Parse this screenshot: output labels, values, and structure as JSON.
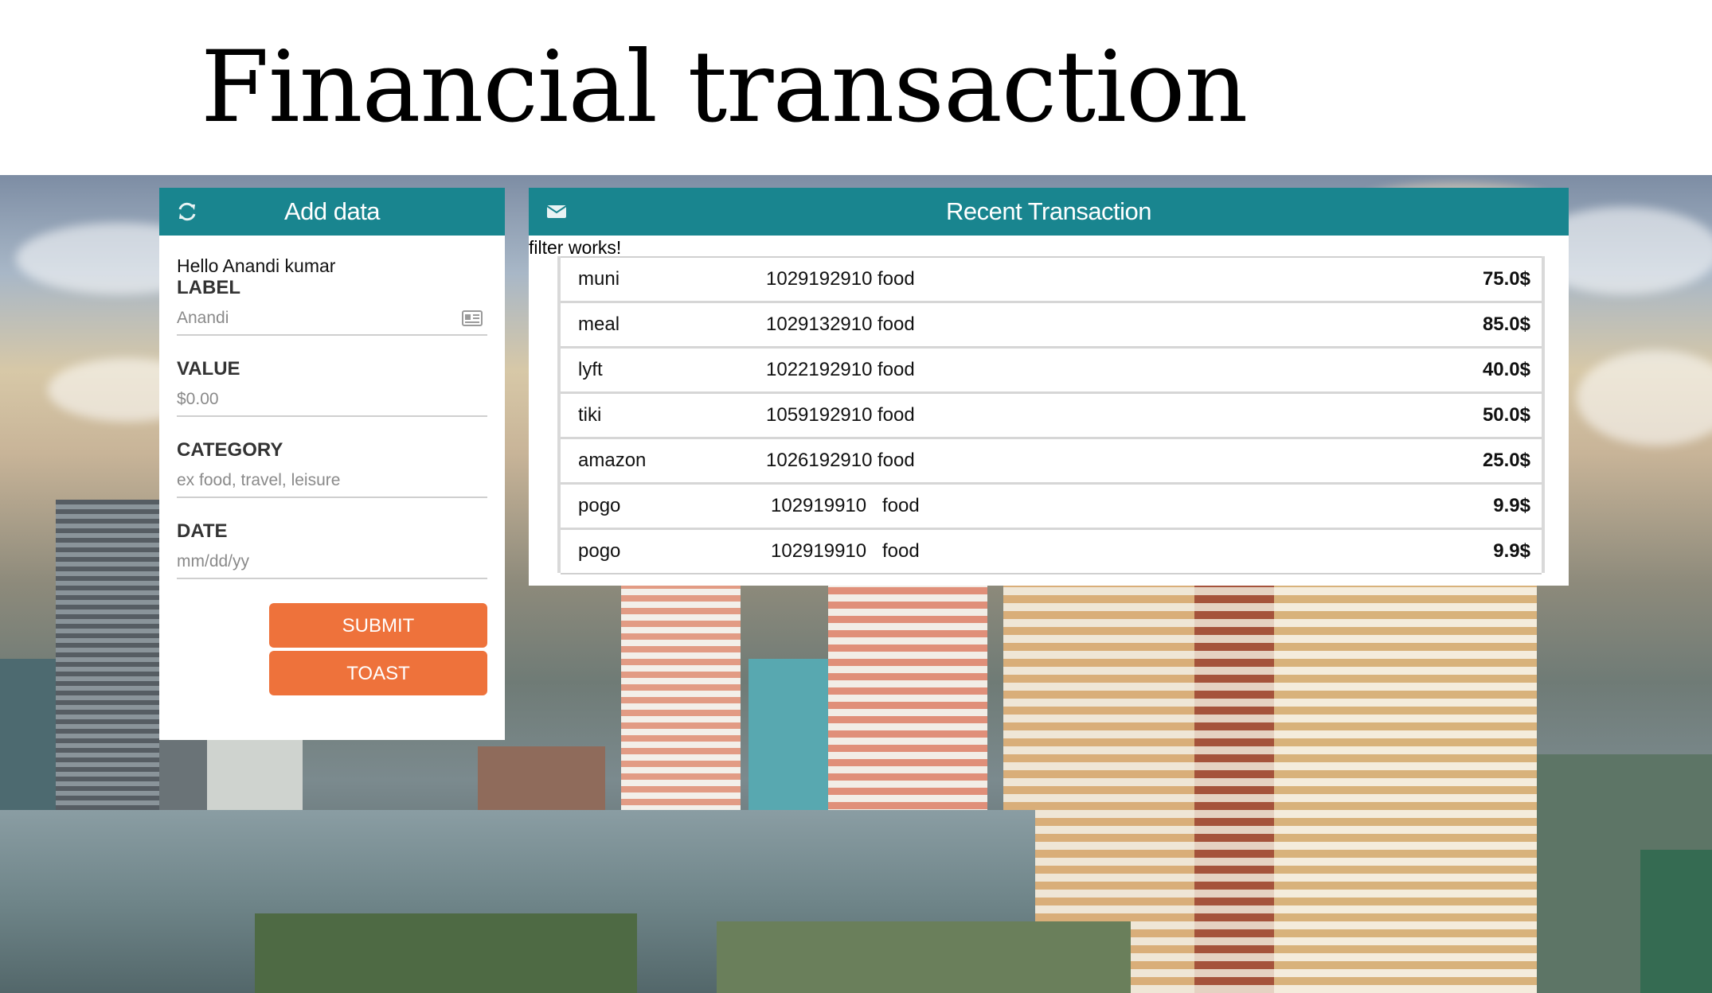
{
  "page": {
    "title": "Financial transaction"
  },
  "add_panel": {
    "title": "Add data",
    "header_icon": "refresh-icon",
    "greeting": "Hello Anandi kumar",
    "fields": {
      "label": {
        "label": "LABEL",
        "placeholder": "Anandi",
        "icon": "contact-card-icon"
      },
      "value": {
        "label": "VALUE",
        "placeholder": "$0.00"
      },
      "category": {
        "label": "CATEGORY",
        "placeholder": "ex food, travel, leisure"
      },
      "date": {
        "label": "DATE",
        "placeholder": "mm/dd/yy"
      }
    },
    "submit_label": "SUBMIT",
    "toast_label": "TOAST"
  },
  "transactions_panel": {
    "title": "Recent Transaction",
    "header_icon": "envelope-icon",
    "filter_message": "filter works!",
    "rows": [
      {
        "label": "muni",
        "id": "1029192910",
        "category": "food",
        "amount": "75.0$"
      },
      {
        "label": "meal",
        "id": "1029132910",
        "category": "food",
        "amount": "85.0$"
      },
      {
        "label": "lyft",
        "id": "1022192910",
        "category": "food",
        "amount": "40.0$"
      },
      {
        "label": "tiki",
        "id": "1059192910",
        "category": "food",
        "amount": "50.0$"
      },
      {
        "label": "amazon",
        "id": "1026192910",
        "category": "food",
        "amount": "25.0$"
      },
      {
        "label": "pogo",
        "id": "102919910",
        "category": "food",
        "amount": "9.9$"
      },
      {
        "label": "pogo",
        "id": "102919910",
        "category": "food",
        "amount": "9.9$"
      }
    ]
  },
  "colors": {
    "header_teal": "#19858f",
    "button_orange": "#ee723b"
  }
}
